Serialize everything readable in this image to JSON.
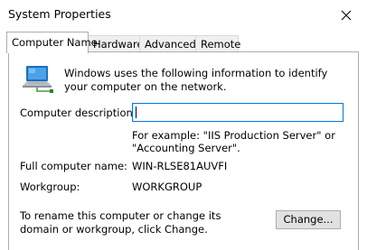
{
  "window": {
    "title": "System Properties"
  },
  "tabs": [
    {
      "label": "Computer Name"
    },
    {
      "label": "Hardware"
    },
    {
      "label": "Advanced"
    },
    {
      "label": "Remote"
    }
  ],
  "computer_name": {
    "intro": "Windows uses the following information to identify your computer on the network.",
    "description_label": "Computer description:",
    "description_value": "",
    "example": "For example: \"IIS Production Server\" or \"Accounting Server\".",
    "full_name_label": "Full computer name:",
    "full_name_value": "WIN-RLSE81AUVFI",
    "workgroup_label": "Workgroup:",
    "workgroup_value": "WORKGROUP",
    "rename_text": "To rename this computer or change its domain or workgroup, click Change.",
    "change_button": "Change..."
  },
  "icons": [
    "computer-network-icon",
    "close-icon"
  ]
}
